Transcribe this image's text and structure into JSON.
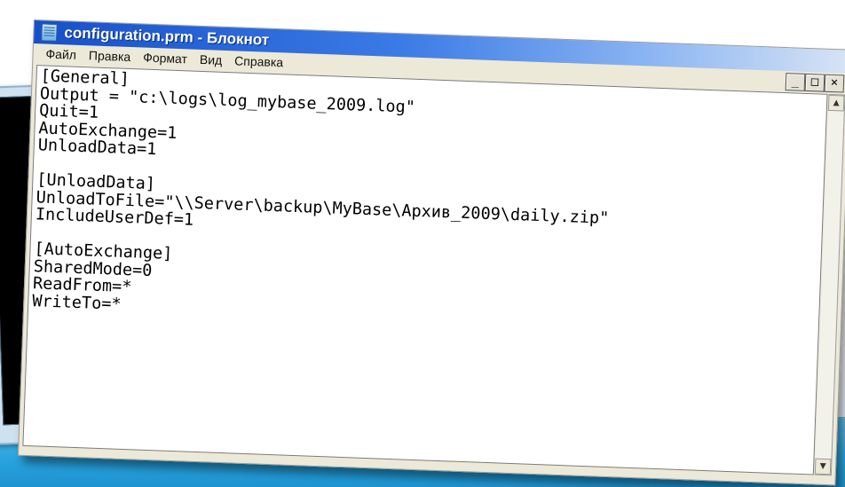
{
  "notepad": {
    "title": "configuration.prm - Блокнот",
    "menu": [
      {
        "label": "Файл"
      },
      {
        "label": "Правка"
      },
      {
        "label": "Формат"
      },
      {
        "label": "Вид"
      },
      {
        "label": "Справка"
      }
    ],
    "window_buttons": {
      "minimize": "_",
      "maximize": "□",
      "close": "×"
    },
    "content": "[General]\nOutput = \"c:\\logs\\log_mybase_2009.log\"\nQuit=1\nAutoExchange=1\nUnloadData=1\n\n[UnloadData]\nUnloadToFile=\"\\\\Server\\backup\\MyBase\\Архив_2009\\daily.zip\"\nIncludeUserDef=1\n\n[AutoExchange]\nSharedMode=0\nReadFrom=*\nWriteTo=*",
    "scroll_up": "▲",
    "scroll_down": "▼"
  },
  "background_window": {
    "scroll_down": "▼",
    "scroll_mid": "≡"
  },
  "colors": {
    "titlebar_start": "#1650c9",
    "slide_blue": "#2aa3de"
  }
}
